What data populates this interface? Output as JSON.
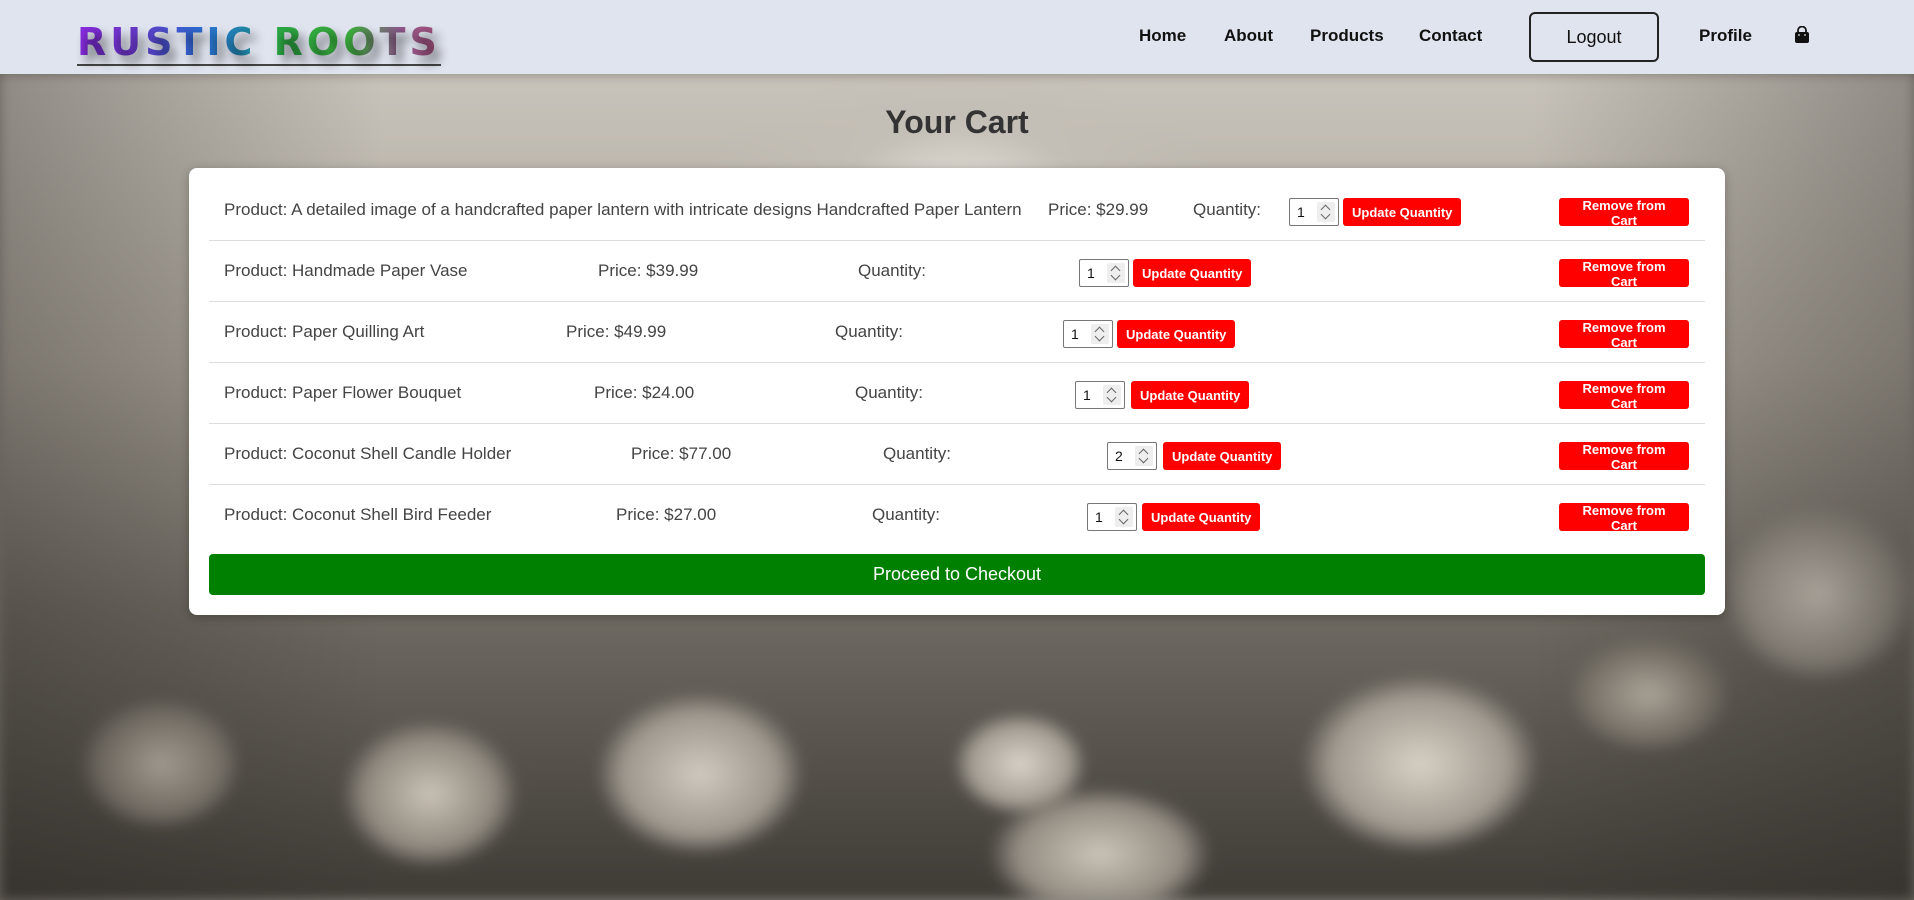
{
  "brand": {
    "word1": "RUSTIC",
    "word2": "ROOTS"
  },
  "nav": {
    "home": "Home",
    "about": "About",
    "products": "Products",
    "contact": "Contact",
    "logout": "Logout",
    "profile": "Profile",
    "cart_icon": "shopping-bag-icon"
  },
  "page": {
    "title": "Your Cart"
  },
  "cart": {
    "items": [
      {
        "product": "Product: A detailed image of a handcrafted paper lantern with intricate designs Handcrafted Paper Lantern",
        "price": "Price: $29.99",
        "quantity_label": "Quantity:",
        "quantity": "1",
        "update_label": "Update Quantity",
        "remove_label": "Remove from Cart"
      },
      {
        "product": "Product: Handmade Paper Vase",
        "price": "Price: $39.99",
        "quantity_label": "Quantity:",
        "quantity": "1",
        "update_label": "Update Quantity",
        "remove_label": "Remove from Cart"
      },
      {
        "product": "Product: Paper Quilling Art",
        "price": "Price: $49.99",
        "quantity_label": "Quantity:",
        "quantity": "1",
        "update_label": "Update Quantity",
        "remove_label": "Remove from Cart"
      },
      {
        "product": "Product: Paper Flower Bouquet",
        "price": "Price: $24.00",
        "quantity_label": "Quantity:",
        "quantity": "1",
        "update_label": "Update Quantity",
        "remove_label": "Remove from Cart"
      },
      {
        "product": "Product: Coconut Shell Candle Holder",
        "price": "Price: $77.00",
        "quantity_label": "Quantity:",
        "quantity": "2",
        "update_label": "Update Quantity",
        "remove_label": "Remove from Cart"
      },
      {
        "product": "Product: Coconut Shell Bird Feeder",
        "price": "Price: $27.00",
        "quantity_label": "Quantity:",
        "quantity": "1",
        "update_label": "Update Quantity",
        "remove_label": "Remove from Cart"
      }
    ],
    "checkout_label": "Proceed to Checkout"
  },
  "colors": {
    "nav_bg": "#e0e4ef",
    "danger": "#ff0000",
    "checkout": "#008000"
  }
}
